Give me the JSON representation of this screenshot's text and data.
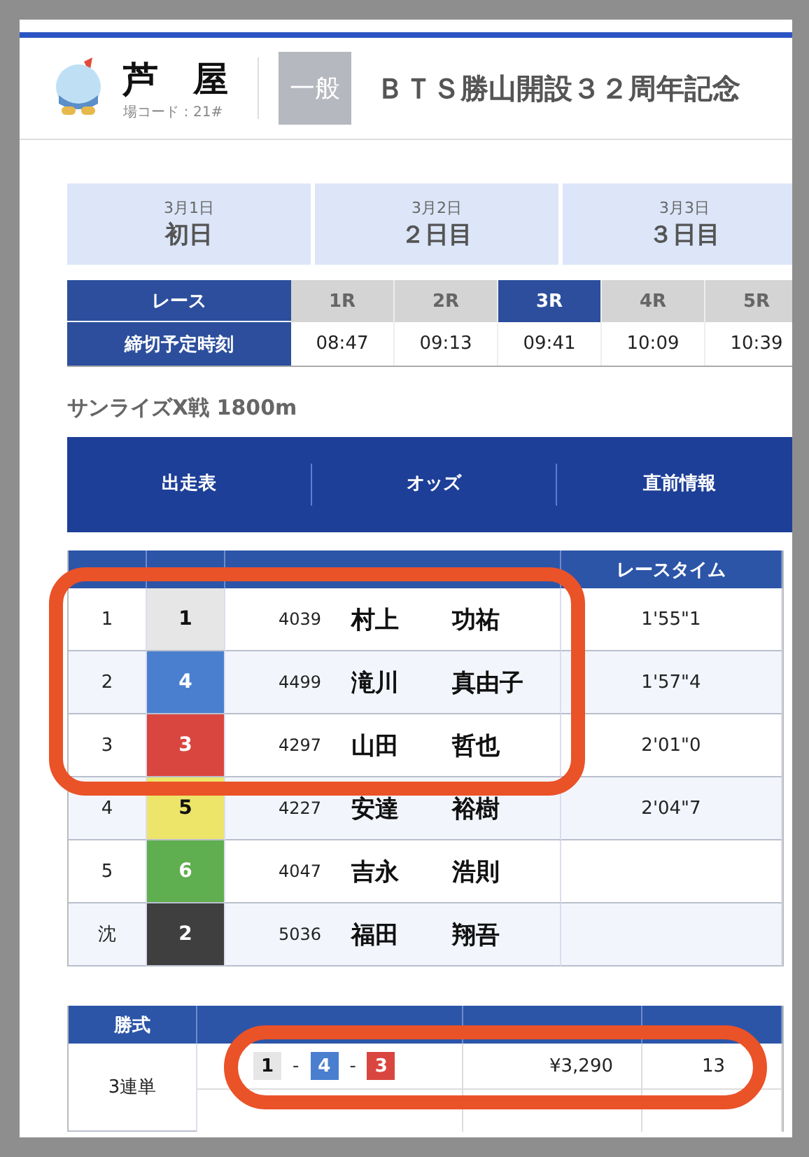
{
  "venue": {
    "name": "芦　屋",
    "code": "場コード：21#"
  },
  "grade": "一般",
  "title": "ＢＴＳ勝山開設３２周年記念",
  "days": [
    {
      "date": "3月1日",
      "label": "初日"
    },
    {
      "date": "3月2日",
      "label": "２日目"
    },
    {
      "date": "3月3日",
      "label": "３日目"
    }
  ],
  "races": {
    "header": "レース",
    "deadline_label": "締切予定時刻",
    "items": [
      {
        "label": "1R",
        "time": "08:47",
        "selected": false
      },
      {
        "label": "2R",
        "time": "09:13",
        "selected": false
      },
      {
        "label": "3R",
        "time": "09:41",
        "selected": true
      },
      {
        "label": "4R",
        "time": "10:09",
        "selected": false
      },
      {
        "label": "5R",
        "time": "10:39",
        "selected": false
      }
    ]
  },
  "race_title": "サンライズX戦 1800m",
  "nav": [
    "出走表",
    "オッズ",
    "直前情報"
  ],
  "results": {
    "time_column": "レースタイム",
    "rows": [
      {
        "rank": "1",
        "boat": "1",
        "color": "#e6e6e6",
        "racer_id": "4039",
        "surname": "村上",
        "given_name": "功祐",
        "time": "1'55\"1",
        "highlighted": true
      },
      {
        "rank": "2",
        "boat": "4",
        "color": "#4a7fd0",
        "racer_id": "4499",
        "surname": "滝川",
        "given_name": "真由子",
        "time": "1'57\"4",
        "highlighted": true
      },
      {
        "rank": "3",
        "boat": "3",
        "color": "#d9463f",
        "racer_id": "4297",
        "surname": "山田",
        "given_name": "哲也",
        "time": "2'01\"0",
        "highlighted": true
      },
      {
        "rank": "4",
        "boat": "5",
        "color": "#ede56a",
        "racer_id": "4227",
        "surname": "安達",
        "given_name": "裕樹",
        "time": "2'04\"7",
        "highlighted": false
      },
      {
        "rank": "5",
        "boat": "6",
        "color": "#5fae4f",
        "racer_id": "4047",
        "surname": "吉永",
        "given_name": "浩則",
        "highlighted": false
      },
      {
        "rank": "沈",
        "boat": "2",
        "color": "#3f3f3f",
        "racer_id": "5036",
        "surname": "福田",
        "given_name": "翔吾",
        "highlighted": false
      }
    ]
  },
  "payouts": {
    "type_column": "勝式",
    "rows": [
      {
        "type": "3連単",
        "combination": [
          {
            "boat": "1",
            "color": "#e6e6e6"
          },
          {
            "boat": "4",
            "color": "#4a7fd0"
          },
          {
            "boat": "3",
            "color": "#d9463f"
          }
        ],
        "separator": "-",
        "amount": "¥3,290",
        "popularity": "13",
        "highlighted": true
      }
    ]
  }
}
